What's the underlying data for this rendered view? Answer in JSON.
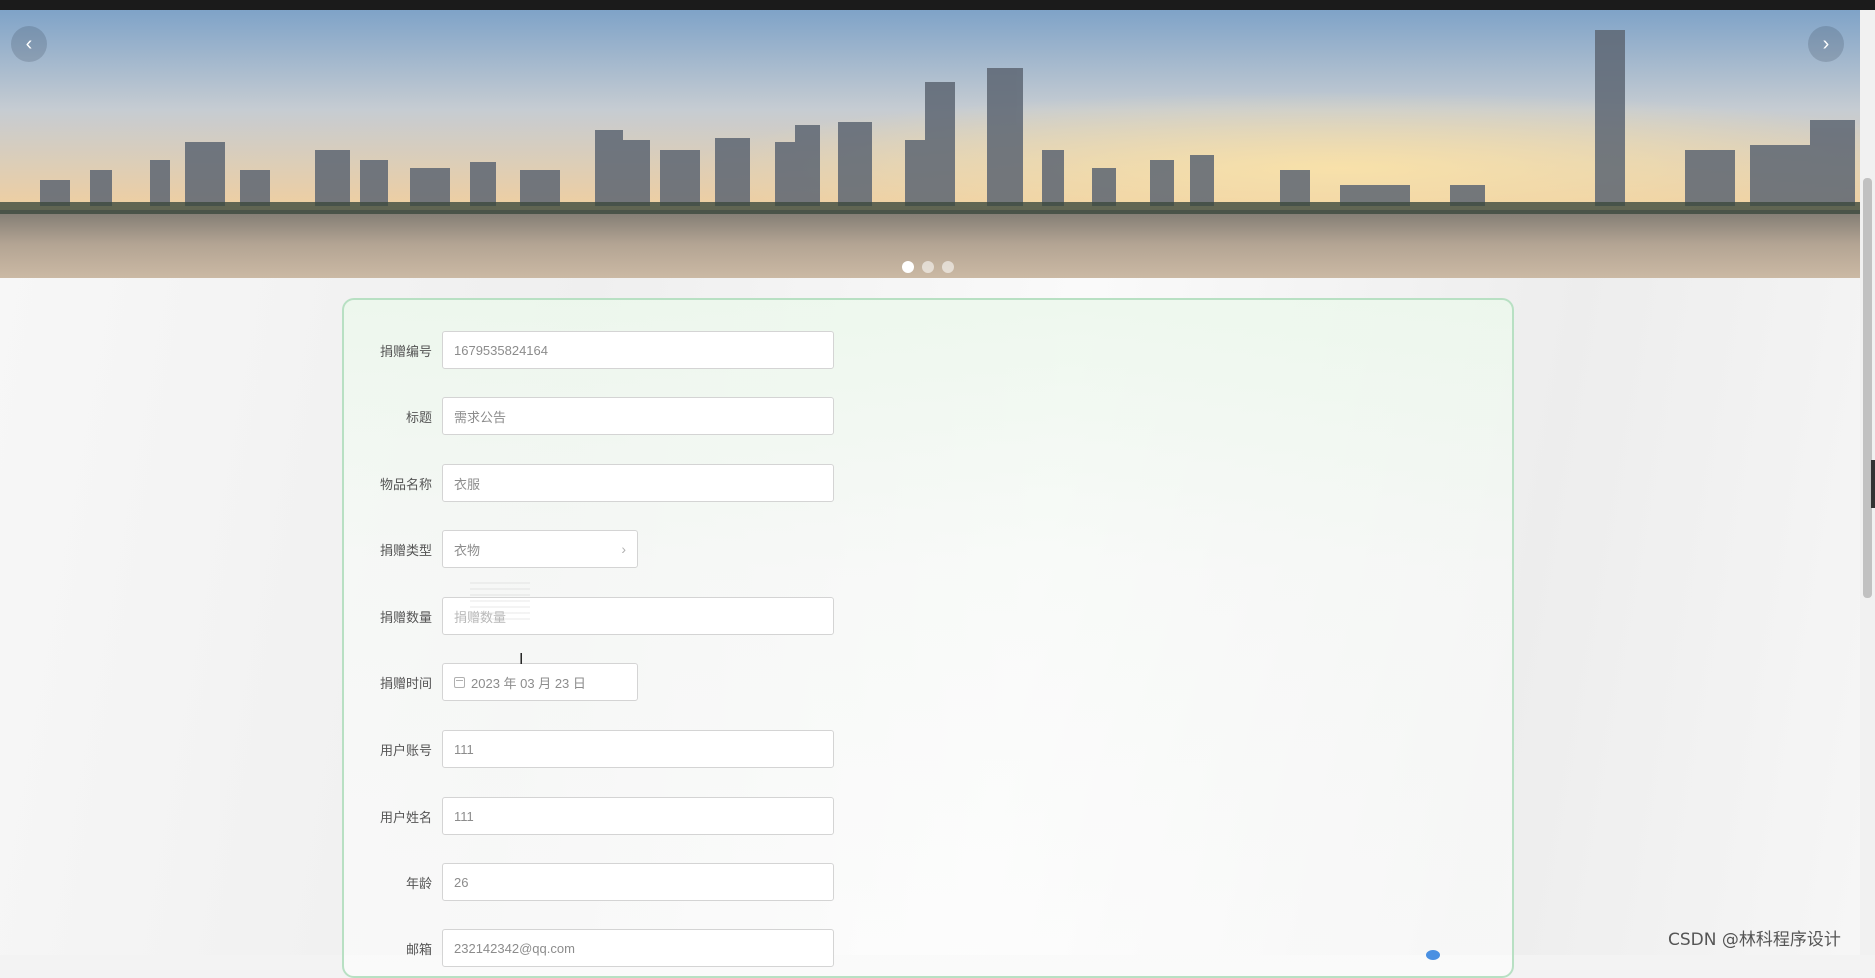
{
  "carousel": {
    "prev_icon": "‹",
    "next_icon": "›",
    "dots": 3,
    "active_index": 0
  },
  "form": {
    "fields": [
      {
        "label": "捐赠编号",
        "value": "1679535824164",
        "type": "text"
      },
      {
        "label": "标题",
        "value": "需求公告",
        "type": "text"
      },
      {
        "label": "物品名称",
        "value": "衣服",
        "type": "text"
      },
      {
        "label": "捐赠类型",
        "value": "衣物",
        "type": "cascader"
      },
      {
        "label": "捐赠数量",
        "value": "捐赠数量",
        "type": "text",
        "placeholder": true
      },
      {
        "label": "捐赠时间",
        "value": "2023 年 03 月 23 日",
        "type": "date"
      },
      {
        "label": "用户账号",
        "value": "111",
        "type": "text"
      },
      {
        "label": "用户姓名",
        "value": "111",
        "type": "text"
      },
      {
        "label": "年龄",
        "value": "26",
        "type": "text"
      },
      {
        "label": "邮箱",
        "value": "232142342@qq.com",
        "type": "text"
      }
    ],
    "cascader_arrow": "›"
  },
  "watermark": "CSDN @林科程序设计",
  "colors": {
    "card_border": "#b8e0c3",
    "input_border": "#d4d4d4",
    "label": "#555555",
    "value": "#8c8c8c"
  }
}
